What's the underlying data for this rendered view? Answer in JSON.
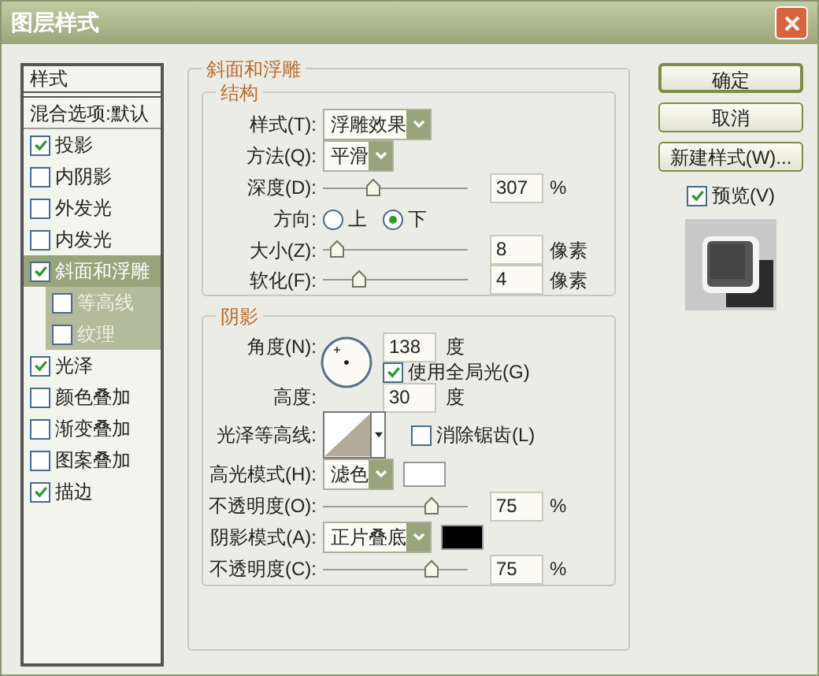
{
  "window": {
    "title": "图层样式"
  },
  "styles_list": {
    "header": "样式",
    "items": [
      {
        "label": "混合选项:默认",
        "kind": "plain",
        "selected": false
      },
      {
        "label": "投影",
        "kind": "check",
        "checked": true,
        "selected": false
      },
      {
        "label": "内阴影",
        "kind": "check",
        "checked": false,
        "selected": false
      },
      {
        "label": "外发光",
        "kind": "check",
        "checked": false,
        "selected": false
      },
      {
        "label": "内发光",
        "kind": "check",
        "checked": false,
        "selected": false
      },
      {
        "label": "斜面和浮雕",
        "kind": "check",
        "checked": true,
        "selected": true,
        "children": [
          {
            "label": "等高线",
            "kind": "check",
            "checked": false,
            "selected": false
          },
          {
            "label": "纹理",
            "kind": "check",
            "checked": false,
            "selected": false
          }
        ]
      },
      {
        "label": "光泽",
        "kind": "check",
        "checked": true,
        "selected": false
      },
      {
        "label": "颜色叠加",
        "kind": "check",
        "checked": false,
        "selected": false
      },
      {
        "label": "渐变叠加",
        "kind": "check",
        "checked": false,
        "selected": false
      },
      {
        "label": "图案叠加",
        "kind": "check",
        "checked": false,
        "selected": false
      },
      {
        "label": "描边",
        "kind": "check",
        "checked": true,
        "selected": false
      }
    ]
  },
  "bevel": {
    "title": "斜面和浮雕",
    "structure": {
      "title": "结构",
      "style": {
        "label": "样式(T):",
        "value": "浮雕效果"
      },
      "technique": {
        "label": "方法(Q):",
        "value": "平滑"
      },
      "depth": {
        "label": "深度(D):",
        "level": 0.35,
        "value": "307",
        "unit": "%"
      },
      "direction": {
        "label": "方向:",
        "options": [
          {
            "label": "上",
            "selected": false
          },
          {
            "label": "下",
            "selected": true
          }
        ]
      },
      "size": {
        "label": "大小(Z):",
        "level": 0.1,
        "value": "8",
        "unit": "像素"
      },
      "soften": {
        "label": "软化(F):",
        "level": 0.25,
        "value": "4",
        "unit": "像素"
      }
    },
    "shading": {
      "title": "阴影",
      "angle": {
        "label": "角度(N):",
        "value": "138",
        "unit": "度"
      },
      "global_light": {
        "label": "使用全局光(G)",
        "checked": true
      },
      "altitude": {
        "label": "高度:",
        "value": "30",
        "unit": "度"
      },
      "gloss_contour": {
        "label": "光泽等高线:"
      },
      "anti_aliased": {
        "label": "消除锯齿(L)",
        "checked": false
      },
      "highlight_mode": {
        "label": "高光模式(H):",
        "value": "滤色",
        "color": "#ffffff"
      },
      "highlight_opacity": {
        "label": "不透明度(O):",
        "level": 0.75,
        "value": "75",
        "unit": "%"
      },
      "shadow_mode": {
        "label": "阴影模式(A):",
        "value": "正片叠底",
        "color": "#000000"
      },
      "shadow_opacity": {
        "label": "不透明度(C):",
        "level": 0.75,
        "value": "75",
        "unit": "%"
      }
    }
  },
  "buttons": [
    {
      "label": "确定",
      "default": true
    },
    {
      "label": "取消",
      "default": false
    },
    {
      "label": "新建样式(W)...",
      "default": false
    }
  ],
  "preview": {
    "label": "预览(V)",
    "checked": true
  }
}
